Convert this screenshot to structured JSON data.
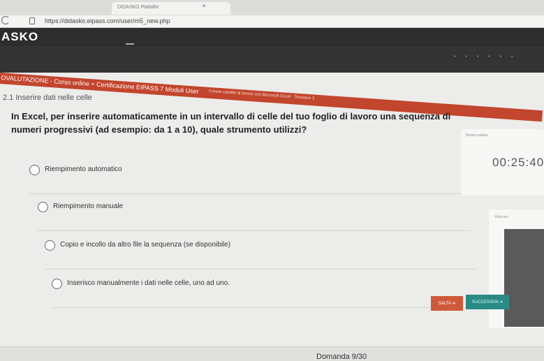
{
  "browser": {
    "tab_title": "DIDASKO Piattafor",
    "tab_close": "×",
    "url": "https://didasko.eipass.com/user/m5_new.php"
  },
  "app": {
    "logo": "ASKO"
  },
  "breadcrumb": {
    "text": "OVALUTAZIONE - Corso online + Certificazione EIPASS 7 Moduli User",
    "extra": "Creare cartelle di lavoro con Microsoft Excel · Tentativo 3"
  },
  "section": {
    "title": "2.1 Inserire dati nelle celle"
  },
  "question": {
    "text": "In Excel, per inserire automaticamente in un intervallo di celle del tuo foglio di lavoro una sequenza di numeri progressivi (ad esempio: da 1 a 10), quale strumento utilizzi?"
  },
  "options": [
    {
      "label": "Riempimento automatico"
    },
    {
      "label": "Riempimento manuale"
    },
    {
      "label": "Copio e incollo da altro file la sequenza (se disponibile)"
    },
    {
      "label": "Inserisco manualmente i dati nelle celle, uno ad uno."
    }
  ],
  "timer": {
    "label": "Tempo residuo",
    "value": "00:25:40"
  },
  "hints": {
    "label": "Webcam"
  },
  "actions": {
    "skip": "SALTA ➔",
    "next": "SUCCESSIVA ➔"
  },
  "footer": {
    "counter": "Domanda 9/30"
  }
}
